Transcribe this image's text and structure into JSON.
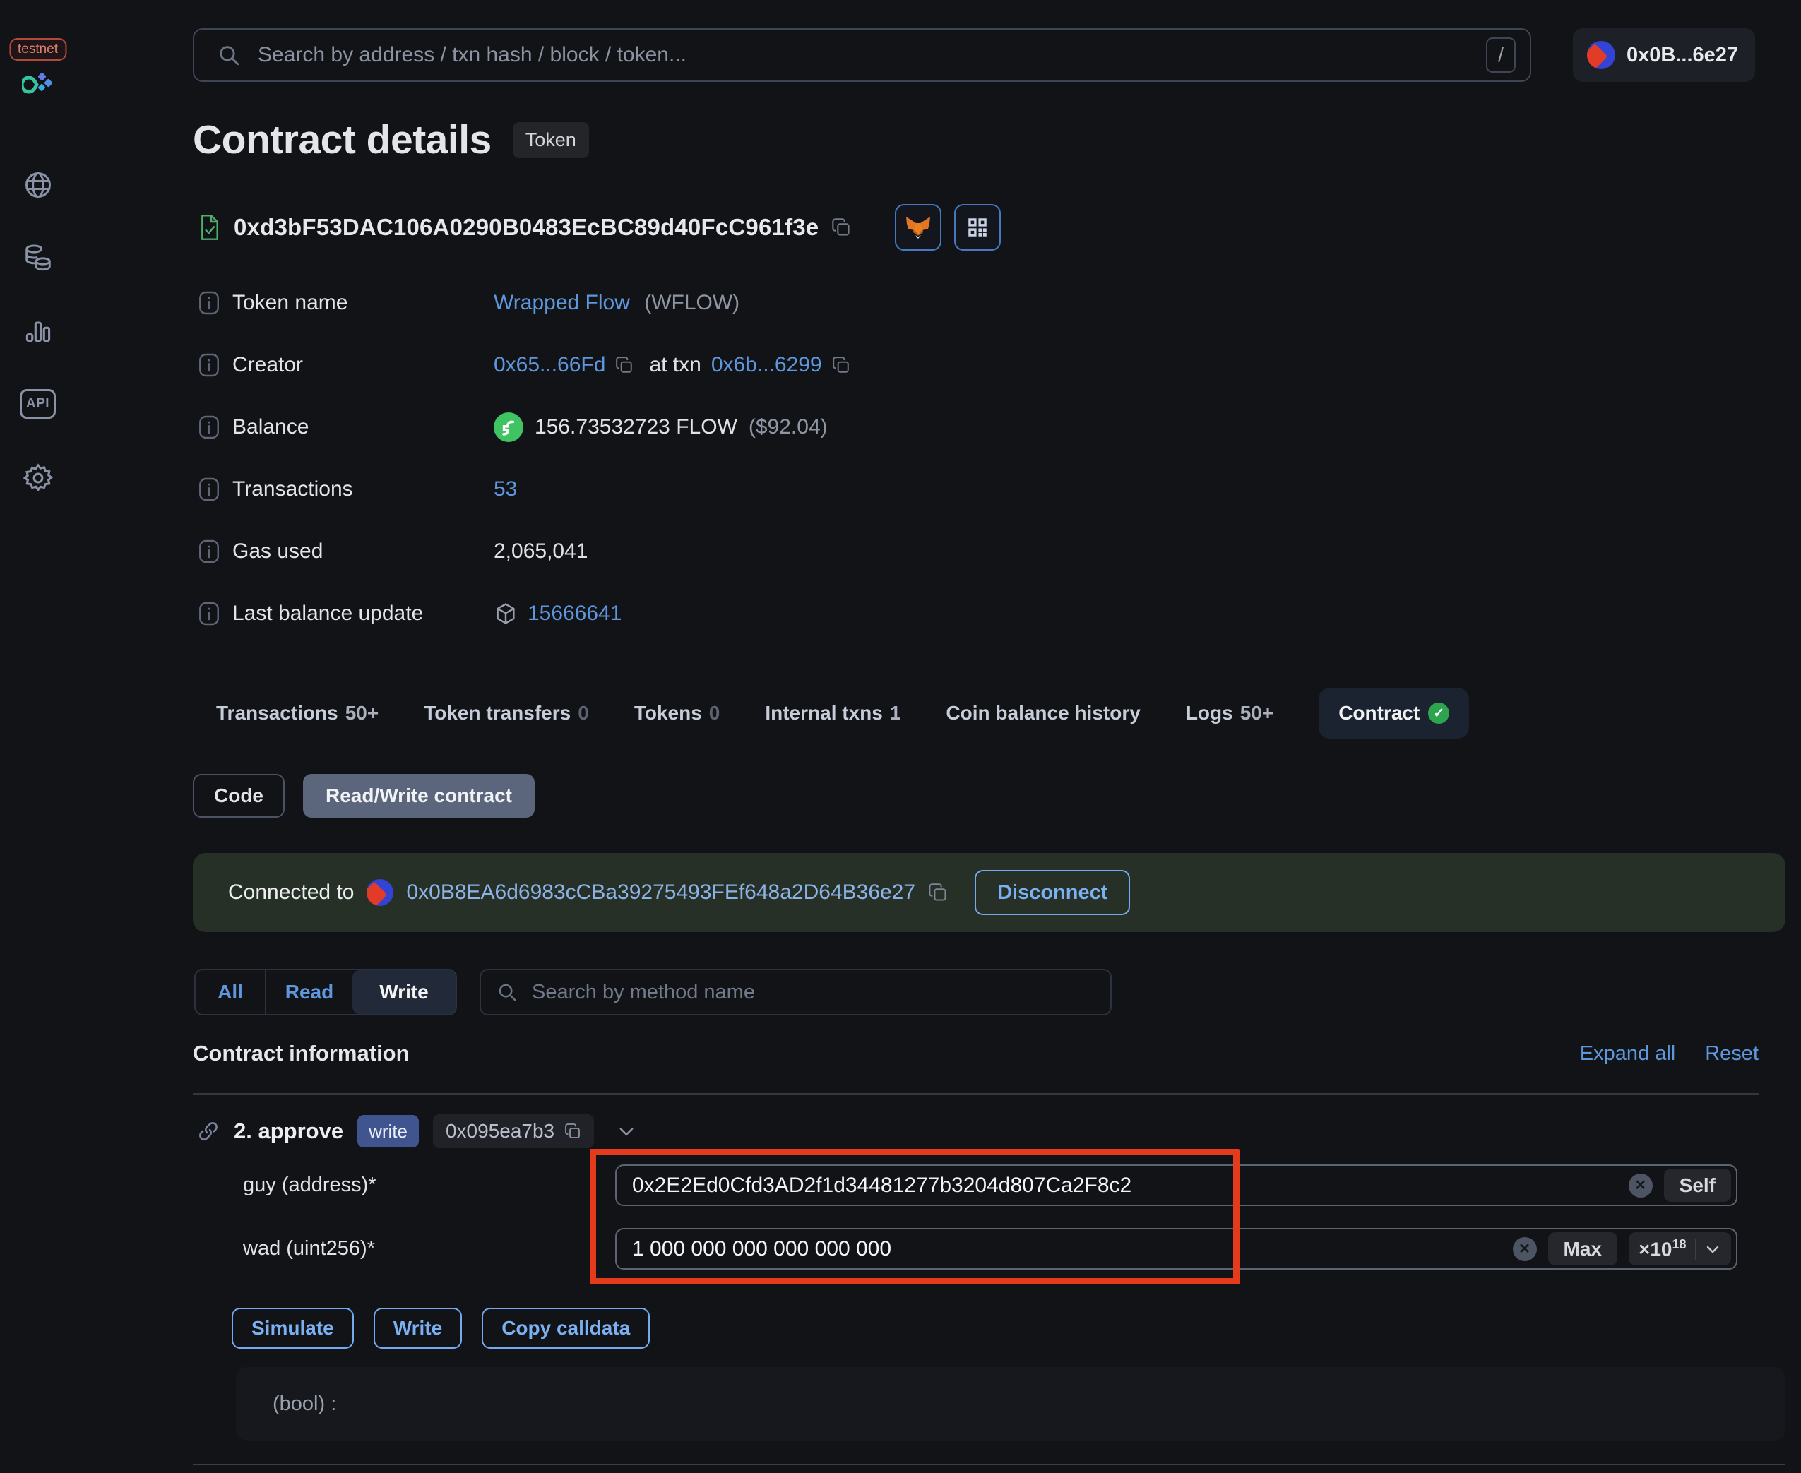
{
  "colors": {
    "accent_blue": "#5e97dd",
    "connected_address_blue": "#8cb3e6",
    "banner_green_bg": "#273027",
    "annotation_red": "#e33b1b",
    "write_badge_blue": "#40548f",
    "verified_green": "#2da44e",
    "flow_green": "#40c463",
    "testnet_red": "#b5483c"
  },
  "sidebar": {
    "network_badge": "testnet",
    "icons": [
      "app-logo",
      "globe",
      "tokens",
      "stats",
      "api",
      "settings"
    ]
  },
  "topbar": {
    "search_placeholder": "Search by address / txn hash / block / token...",
    "shortcut_key": "/",
    "account_label": "0x0B...6e27"
  },
  "header": {
    "title": "Contract details",
    "type_badge": "Token",
    "address": "0xd3bF53DAC106A0290B0483EcBC89d40FcC961f3e"
  },
  "info": {
    "token_name": {
      "label": "Token name",
      "link": "Wrapped Flow",
      "symbol": "(WFLOW)"
    },
    "creator": {
      "label": "Creator",
      "address": "0x65...66Fd",
      "mid": "at txn",
      "txn": "0x6b...6299"
    },
    "balance": {
      "label": "Balance",
      "amount": "156.73532723 FLOW",
      "usd": "($92.04)"
    },
    "transactions": {
      "label": "Transactions",
      "value": "53"
    },
    "gas_used": {
      "label": "Gas used",
      "value": "2,065,041"
    },
    "last_balance_update": {
      "label": "Last balance update",
      "block": "15666641"
    }
  },
  "tabs": {
    "items": [
      {
        "label": "Transactions",
        "count": "50+"
      },
      {
        "label": "Token transfers",
        "count": "0"
      },
      {
        "label": "Tokens",
        "count": "0"
      },
      {
        "label": "Internal txns",
        "count": "1"
      },
      {
        "label": "Coin balance history",
        "count": ""
      },
      {
        "label": "Logs",
        "count": "50+"
      },
      {
        "label": "Contract",
        "count": ""
      }
    ]
  },
  "subtabs": {
    "code": "Code",
    "read_write": "Read/Write contract"
  },
  "connection": {
    "prefix": "Connected to",
    "address": "0x0B8EA6d6983cCBa39275493FEf648a2D64B36e27",
    "disconnect": "Disconnect"
  },
  "filter": {
    "all": "All",
    "read": "Read",
    "write": "Write",
    "search_placeholder": "Search by method name"
  },
  "section": {
    "title": "Contract information",
    "expand_all": "Expand all",
    "reset": "Reset"
  },
  "method": {
    "name": "2. approve",
    "badge": "write",
    "selector": "0x095ea7b3",
    "params": [
      {
        "label": "guy (address)*",
        "value": "0x2E2Ed0Cfd3AD2f1d34481277b3204d807Ca2F8c2",
        "action": "Self"
      },
      {
        "label": "wad (uint256)*",
        "value": "1 000 000 000 000 000 000",
        "action": "Max",
        "multiplier": "×10",
        "exponent": "18"
      }
    ],
    "buttons": {
      "simulate": "Simulate",
      "write": "Write",
      "copy_calldata": "Copy calldata"
    },
    "output": "(bool) :"
  }
}
